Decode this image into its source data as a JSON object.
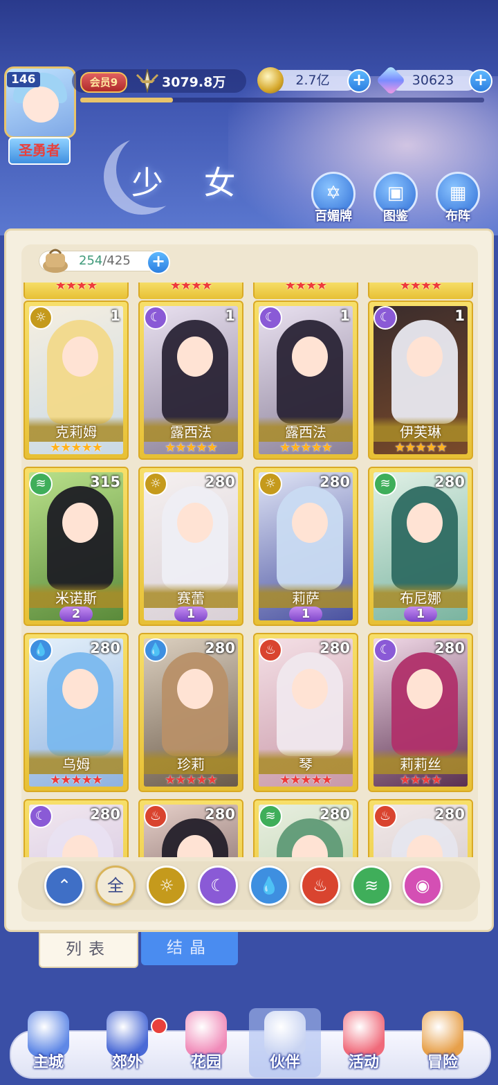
{
  "player": {
    "level": "146",
    "title": "圣勇者",
    "vip": "会员9",
    "power": "3079.8万",
    "exp_progress": 0.23
  },
  "resources": {
    "gold": "2.7亿",
    "gems": "30623"
  },
  "page": {
    "title": "少 女",
    "header_buttons": [
      "百媚牌",
      "图鉴",
      "布阵"
    ]
  },
  "capacity": {
    "current": "254",
    "max": "/425"
  },
  "colors": {
    "light": "#c59a1c",
    "dark": "#8a5ad6",
    "water": "#3e8fe0",
    "fire": "#d9442f",
    "wind": "#3fae5a",
    "chaos": "#d44fb4",
    "red_star": "#ee3b3b",
    "gold_star": "#ffb21e"
  },
  "cards": [
    {
      "name": "克莉姆",
      "element": "light",
      "level": "1",
      "stars": 5,
      "star_color": "gold",
      "hair": "#f2d98a",
      "bg1": "#f6efe0",
      "bg2": "#c9d9e6"
    },
    {
      "name": "露西法",
      "element": "dark",
      "level": "1",
      "stars": 5,
      "star_color": "gold",
      "hair": "#2a2436",
      "bg1": "#e9e1f0",
      "bg2": "#8a8098"
    },
    {
      "name": "露西法",
      "element": "dark",
      "level": "1",
      "stars": 5,
      "star_color": "gold",
      "hair": "#2a2436",
      "bg1": "#e9e1f0",
      "bg2": "#8a8098"
    },
    {
      "name": "伊芙琳",
      "element": "dark",
      "level": "1",
      "stars": 5,
      "star_color": "gold",
      "hair": "#e9e9f0",
      "bg1": "#3a2c2c",
      "bg2": "#7a4a2a"
    },
    {
      "name": "米诺斯",
      "element": "wind",
      "level": "315",
      "wing": "2",
      "hair": "#1e1e24",
      "bg1": "#b9e08a",
      "bg2": "#5a8a3a"
    },
    {
      "name": "赛蕾",
      "element": "light",
      "level": "280",
      "wing": "1",
      "hair": "#eeeef4",
      "bg1": "#f5f0f0",
      "bg2": "#d9d0d6"
    },
    {
      "name": "莉萨",
      "element": "light",
      "level": "280",
      "wing": "1",
      "hair": "#c9dbf2",
      "bg1": "#dfe4f5",
      "bg2": "#4a52a0"
    },
    {
      "name": "布尼娜",
      "element": "wind",
      "level": "280",
      "wing": "1",
      "hair": "#2e6b62",
      "bg1": "#e0f0e6",
      "bg2": "#7ab4a0"
    },
    {
      "name": "乌姆",
      "element": "water",
      "level": "280",
      "stars": 5,
      "star_color": "red",
      "hair": "#7ab8ee",
      "bg1": "#e4f0fa",
      "bg2": "#8fb2e0"
    },
    {
      "name": "珍莉",
      "element": "water",
      "level": "280",
      "stars": 5,
      "star_color": "red",
      "hair": "#b89068",
      "bg1": "#dcd0c0",
      "bg2": "#6a5a4a"
    },
    {
      "name": "琴",
      "element": "fire",
      "level": "280",
      "stars": 5,
      "star_color": "red",
      "hair": "#f0e8ee",
      "bg1": "#f4e0e6",
      "bg2": "#c898a8"
    },
    {
      "name": "莉莉丝",
      "element": "dark",
      "level": "280",
      "stars": 4,
      "star_color": "red",
      "hair": "#b0306a",
      "bg1": "#f0d8e6",
      "bg2": "#5a3050"
    },
    {
      "name": "",
      "element": "dark",
      "level": "280",
      "hair": "#e9e2f2",
      "bg1": "#f2e8f0",
      "bg2": "#c9b9d9"
    },
    {
      "name": "",
      "element": "fire",
      "level": "280",
      "hair": "#24202a",
      "bg1": "#e6d0c9",
      "bg2": "#5a4040"
    },
    {
      "name": "",
      "element": "wind",
      "level": "280",
      "hair": "#5f9a76",
      "bg1": "#e8efe0",
      "bg2": "#b0c8a0"
    },
    {
      "name": "",
      "element": "fire",
      "level": "280",
      "hair": "#e6e6ee",
      "bg1": "#f2e8e8",
      "bg2": "#c9c0c0"
    }
  ],
  "filters": [
    {
      "icon": "upgrade-icon",
      "label": "⌃",
      "color": "#3f6fc6"
    },
    {
      "icon": "all-icon",
      "label": "全",
      "color": "#f2ead6",
      "selected": true
    },
    {
      "icon": "light-icon",
      "label": "☼",
      "color": "#c59a1c"
    },
    {
      "icon": "dark-icon",
      "label": "☾",
      "color": "#8a5ad6"
    },
    {
      "icon": "water-icon",
      "label": "💧",
      "color": "#3e8fe0"
    },
    {
      "icon": "fire-icon",
      "label": "♨",
      "color": "#d9442f"
    },
    {
      "icon": "wind-icon",
      "label": "≋",
      "color": "#3fae5a"
    },
    {
      "icon": "chaos-icon",
      "label": "◉",
      "color": "#d44fb4"
    }
  ],
  "tabs": [
    {
      "label": "列表",
      "active": true
    },
    {
      "label": "结晶",
      "active": false
    }
  ],
  "nav": [
    "主城",
    "郊外",
    "花园",
    "伙伴",
    "活动",
    "冒险"
  ]
}
